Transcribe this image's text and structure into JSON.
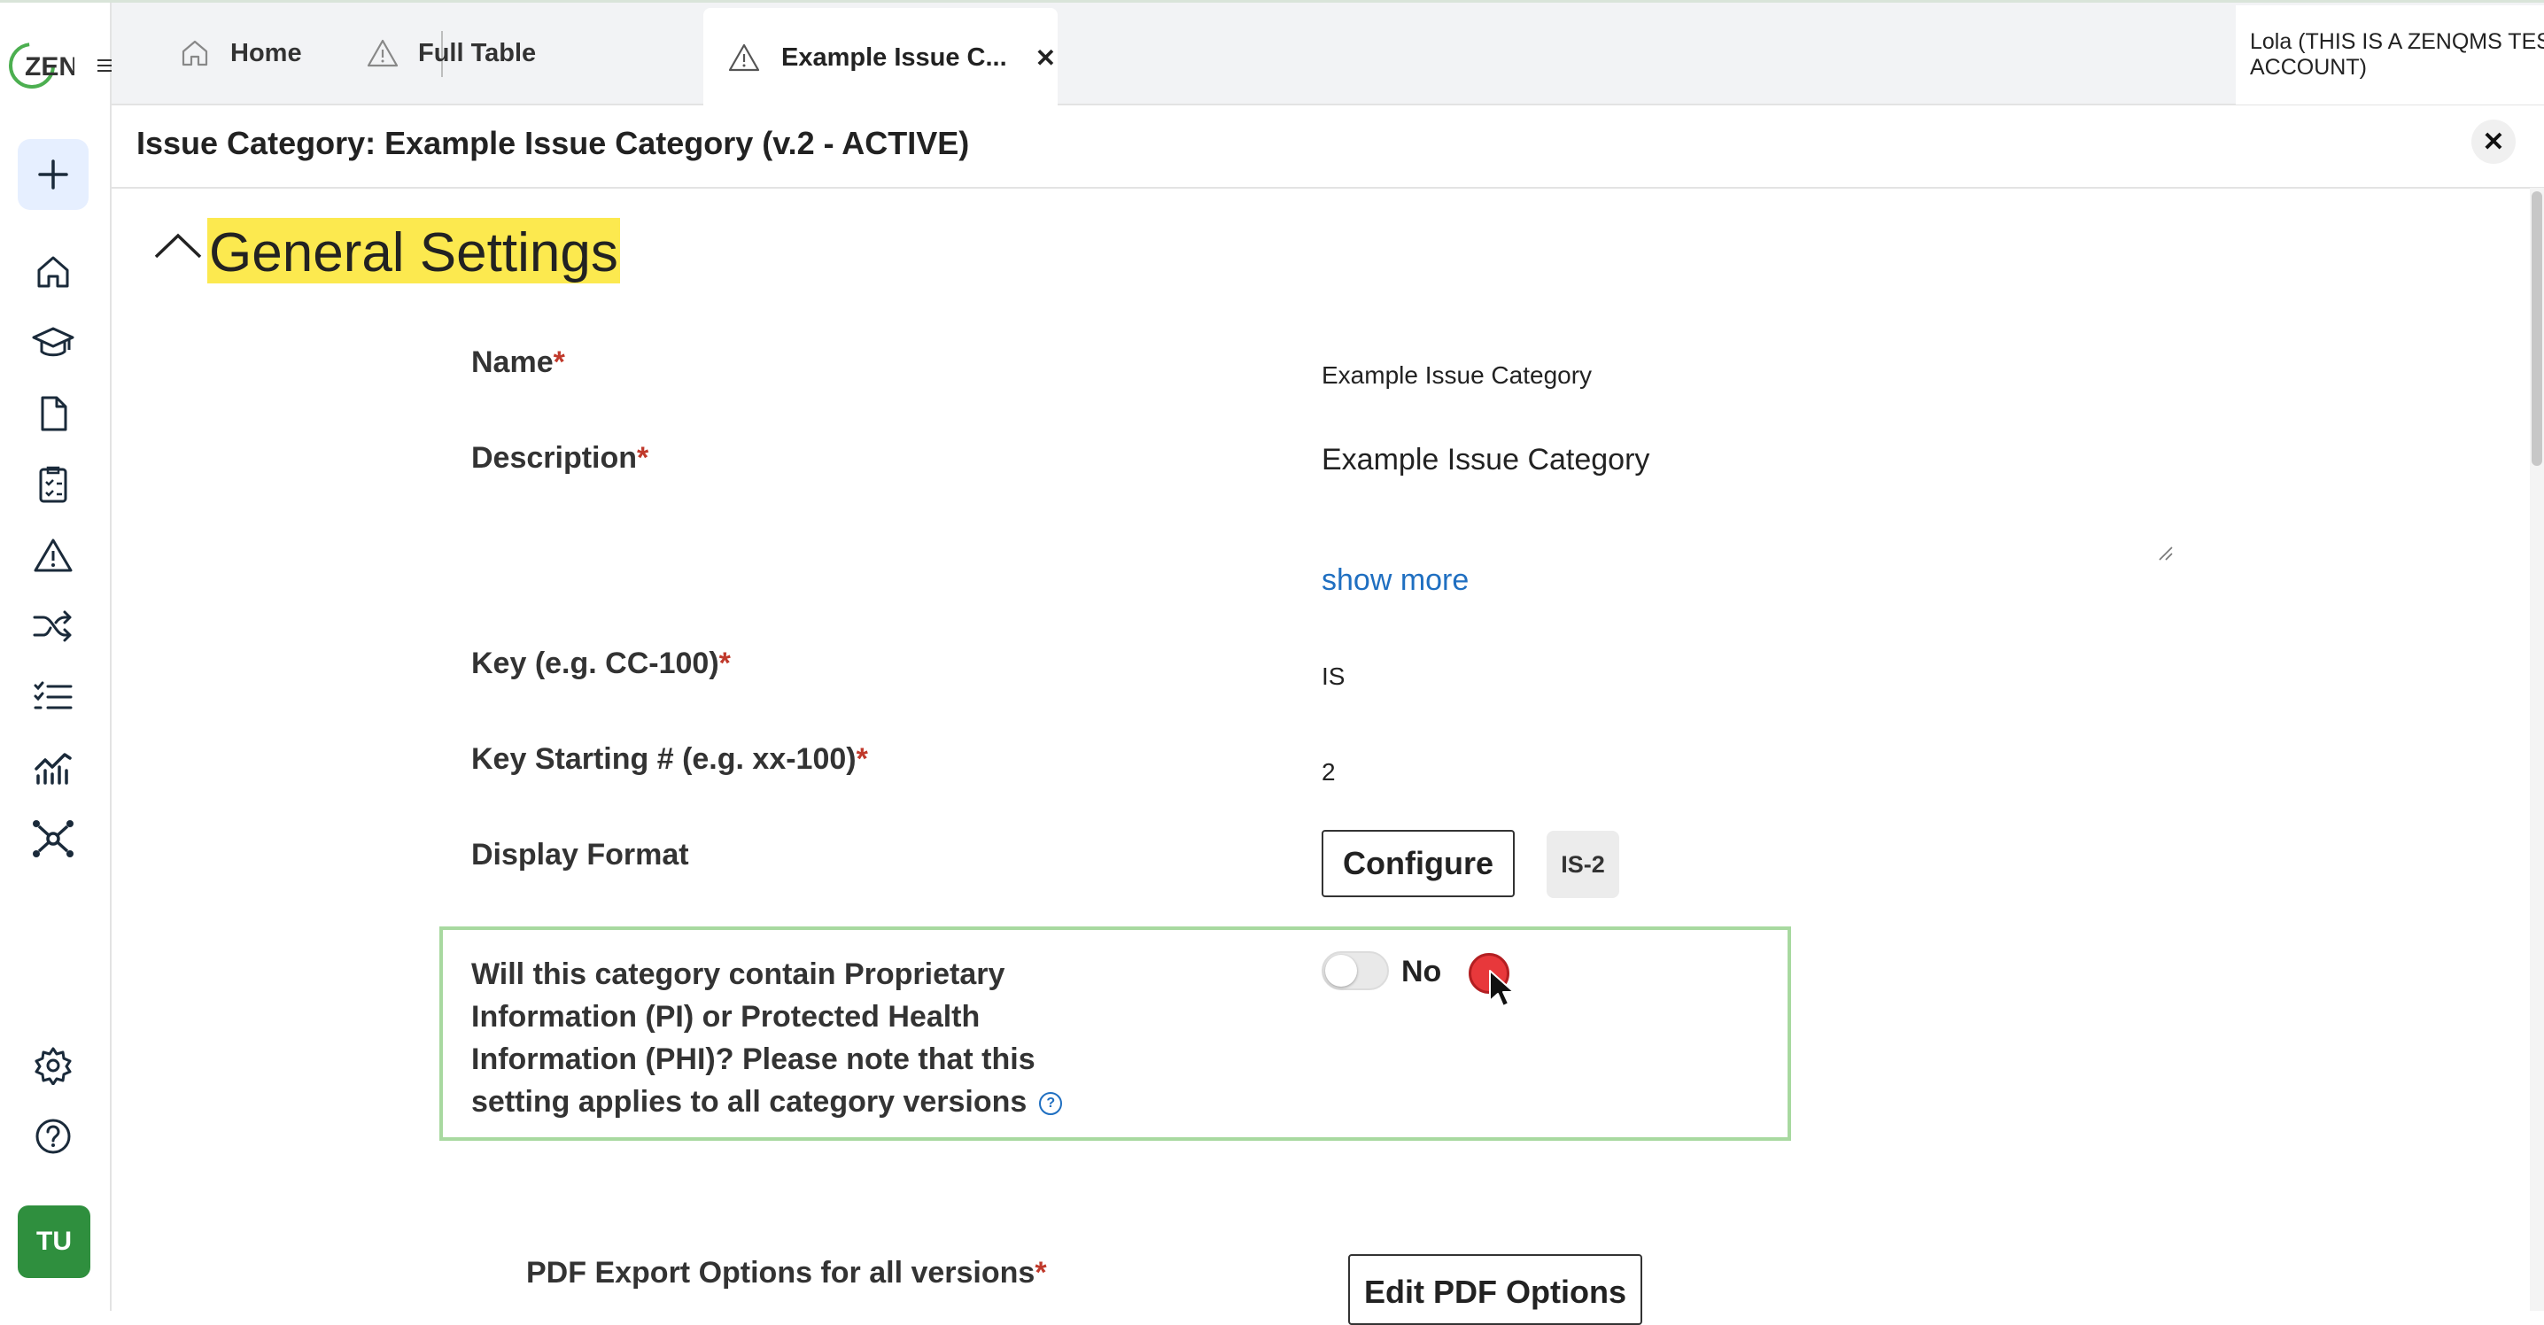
{
  "app": {
    "logo_text": "ZEN"
  },
  "tabs": [
    {
      "label": "Home",
      "icon": "home-icon"
    },
    {
      "label": "Full Table",
      "icon": "warning-icon"
    },
    {
      "label": "Example Issue C...",
      "icon": "warning-icon",
      "active": true
    }
  ],
  "user": {
    "name": "Lola (THIS IS A ZENQMS TEST ACCOUNT)",
    "initials": "TU"
  },
  "header": {
    "title": "Issue Category: Example Issue Category (v.2 - ACTIVE)"
  },
  "section": {
    "title": "General Settings"
  },
  "fields": {
    "name": {
      "label": "Name",
      "required": "*",
      "value": "Example Issue Category"
    },
    "description": {
      "label": "Description",
      "required": "*",
      "value": "Example Issue Category",
      "show_more": "show more"
    },
    "key": {
      "label": "Key (e.g. CC-100)",
      "required": "*",
      "value": "IS"
    },
    "key_start": {
      "label": "Key Starting # (e.g. xx-100)",
      "required": "*",
      "value": "2"
    },
    "display_format": {
      "label": "Display Format",
      "button": "Configure",
      "preview": "IS-2"
    },
    "pi_phi": {
      "label": "Will this category contain Proprietary Information (PI) or Protected Health Information (PHI)? Please note that this setting applies to all category versions",
      "toggle_label": "No",
      "enabled": false
    },
    "pdf_export": {
      "label": "PDF Export Options for all versions",
      "required": "*",
      "button": "Edit PDF Options"
    }
  },
  "colors": {
    "highlight": "#fce94f",
    "link": "#1f6fc1",
    "required": "#c0392b",
    "focus_border": "#a8d9a0",
    "avatar": "#2f8f3e",
    "click_marker": "#e8383b"
  }
}
